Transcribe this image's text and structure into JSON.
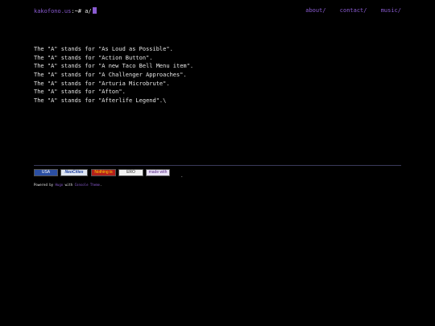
{
  "header": {
    "site": "kakofono.us",
    "path": ":~# a/",
    "nav": [
      {
        "label": "about/"
      },
      {
        "label": "contact/"
      },
      {
        "label": "music/"
      }
    ]
  },
  "content": {
    "lines": [
      "The \"A\" stands for \"As Loud as Possible\".",
      "The \"A\" stands for \"Action Button\".",
      "The \"A\" stands for \"A new Taco Bell Menu item\".",
      "The \"A\" stands for \"A Challenger Approaches\".",
      "The \"A\" stands for \"Arturia Microbrute\".",
      "The \"A\" stands for \"Afton\".",
      "The \"A\" stands for \"Afterlife Legend\".\\"
    ]
  },
  "footer": {
    "badges": [
      {
        "label": "USA"
      },
      {
        "label": "NeoCities"
      },
      {
        "label": "Nothing is Missing"
      },
      {
        "label": "ERO"
      },
      {
        "label": "made with"
      }
    ],
    "dot": ".",
    "powered_prefix": "Powered by",
    "powered_engine": "Hugo",
    "powered_middle": "with",
    "powered_theme": "Console Theme",
    "powered_suffix": "."
  },
  "colors": {
    "accent": "#8a5bd1",
    "background": "#000000",
    "text": "#e6e6e6"
  }
}
